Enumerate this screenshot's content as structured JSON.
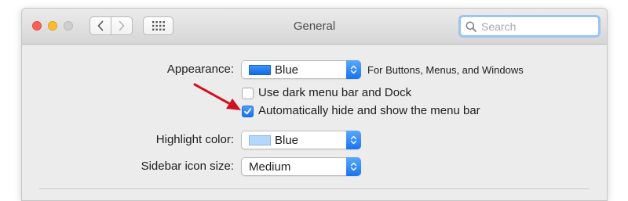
{
  "window": {
    "title": "General",
    "search_placeholder": "Search"
  },
  "controls": {
    "appearance": {
      "label": "Appearance:",
      "value": "Blue",
      "note": "For Buttons, Menus, and Windows",
      "swatch_color": "#1c7cf3"
    },
    "dark_menu": {
      "label": "Use dark menu bar and Dock",
      "checked": false
    },
    "auto_hide": {
      "label": "Automatically hide and show the menu bar",
      "checked": true
    },
    "highlight": {
      "label": "Highlight color:",
      "value": "Blue",
      "swatch_color": "#b3d7ff"
    },
    "sidebar_icon": {
      "label": "Sidebar icon size:",
      "value": "Medium"
    }
  },
  "colors": {
    "accent": "#1b78f2",
    "annotation_arrow": "#d0111f"
  },
  "icons": {
    "back": "chevron-left-icon",
    "forward": "chevron-right-icon",
    "grid": "grid-icon",
    "search": "search-icon",
    "stepper": "up-down-arrows-icon",
    "check": "checkmark-icon"
  }
}
